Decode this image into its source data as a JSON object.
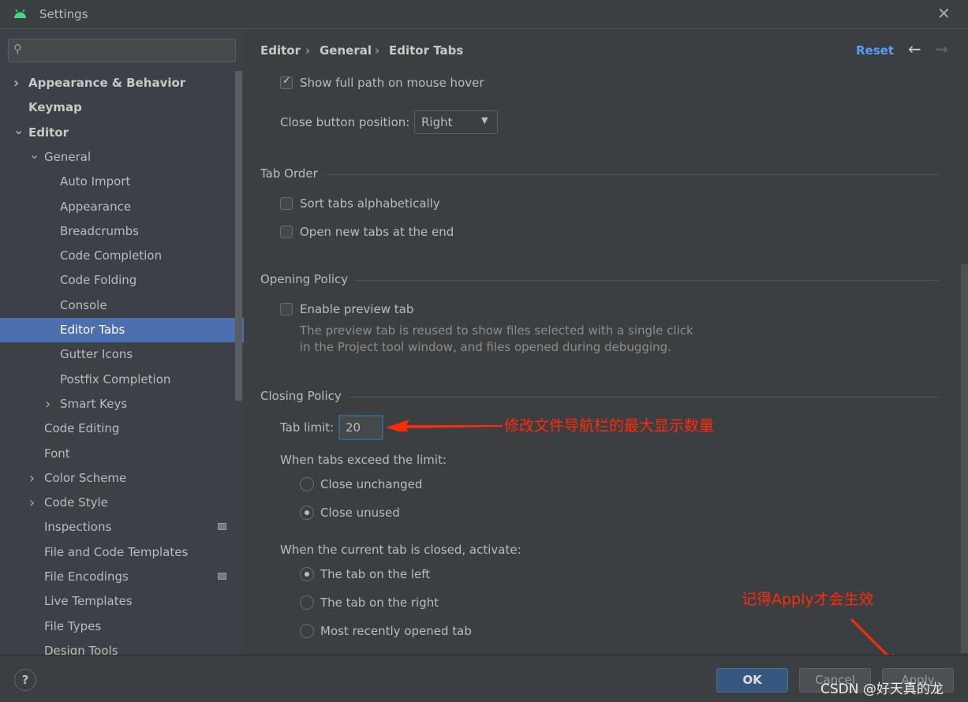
{
  "window": {
    "title": "Settings",
    "close_icon": "close-icon",
    "logo": "android-icon"
  },
  "search": {
    "placeholder": "",
    "value": ""
  },
  "sidebar": {
    "items": [
      {
        "label": "Appearance & Behavior",
        "level": 0,
        "bold": true,
        "chevron": "right"
      },
      {
        "label": "Keymap",
        "level": 0,
        "bold": true
      },
      {
        "label": "Editor",
        "level": 0,
        "bold": true,
        "chevron": "down"
      },
      {
        "label": "General",
        "level": 1,
        "chevron": "down"
      },
      {
        "label": "Auto Import",
        "level": 2
      },
      {
        "label": "Appearance",
        "level": 2
      },
      {
        "label": "Breadcrumbs",
        "level": 2
      },
      {
        "label": "Code Completion",
        "level": 2
      },
      {
        "label": "Code Folding",
        "level": 2
      },
      {
        "label": "Console",
        "level": 2
      },
      {
        "label": "Editor Tabs",
        "level": 2,
        "selected": true
      },
      {
        "label": "Gutter Icons",
        "level": 2
      },
      {
        "label": "Postfix Completion",
        "level": 2
      },
      {
        "label": "Smart Keys",
        "level": 2,
        "chevron": "right"
      },
      {
        "label": "Code Editing",
        "level": 1
      },
      {
        "label": "Font",
        "level": 1
      },
      {
        "label": "Color Scheme",
        "level": 1,
        "chevron": "right"
      },
      {
        "label": "Code Style",
        "level": 1,
        "chevron": "right"
      },
      {
        "label": "Inspections",
        "level": 1,
        "badge": true
      },
      {
        "label": "File and Code Templates",
        "level": 1
      },
      {
        "label": "File Encodings",
        "level": 1,
        "badge": true
      },
      {
        "label": "Live Templates",
        "level": 1
      },
      {
        "label": "File Types",
        "level": 1
      },
      {
        "label": "Design Tools",
        "level": 1
      }
    ]
  },
  "breadcrumb": [
    "Editor",
    "General",
    "Editor Tabs"
  ],
  "header": {
    "reset": "Reset",
    "accent": "#589df6"
  },
  "content": {
    "show_full_path": "Show full path on mouse hover",
    "close_button_label": "Close button position:",
    "close_button_value": "Right",
    "tab_order": "Tab Order",
    "sort_alpha": "Sort tabs alphabetically",
    "open_end": "Open new tabs at the end",
    "opening_policy": "Opening Policy",
    "preview_tab": "Enable preview tab",
    "preview_desc1": "The preview tab is reused to show files selected with a single click",
    "preview_desc2": "in the Project tool window, and files opened during debugging.",
    "closing_policy": "Closing Policy",
    "tab_limit_label": "Tab limit:",
    "tab_limit_value": "20",
    "exceed_label": "When tabs exceed the limit:",
    "close_unchanged": "Close unchanged",
    "close_unused": "Close unused",
    "closed_label": "When the current tab is closed, activate:",
    "tab_left": "The tab on the left",
    "tab_right": "The tab on the right",
    "most_recent": "Most recently opened tab"
  },
  "annotations": {
    "arrow1": "修改文件导航栏的最大显示数量",
    "arrow2": "记得Apply才会生效",
    "color": "#ff2a0a"
  },
  "footer": {
    "help": "?",
    "ok": "OK",
    "cancel": "Cancel",
    "apply": "Apply"
  },
  "watermark": "CSDN @好天真的龙"
}
